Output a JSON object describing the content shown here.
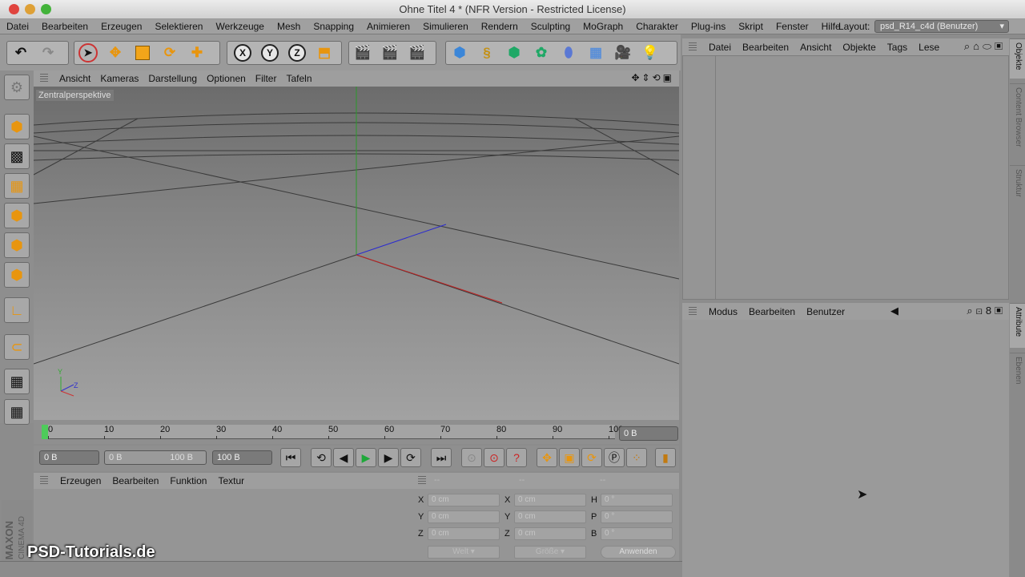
{
  "window": {
    "title": "Ohne Titel 4 * (NFR Version - Restricted License)"
  },
  "menubar": {
    "items": [
      "Datei",
      "Bearbeiten",
      "Erzeugen",
      "Selektieren",
      "Werkzeuge",
      "Mesh",
      "Snapping",
      "Animieren",
      "Simulieren",
      "Rendern",
      "Sculpting",
      "MoGraph",
      "Charakter",
      "Plug-ins",
      "Skript",
      "Fenster",
      "Hilfe"
    ],
    "layout_label": "Layout:",
    "layout_value": "psd_R14_c4d (Benutzer)"
  },
  "toolbar": {
    "axis_x": "X",
    "axis_y": "Y",
    "axis_z": "Z"
  },
  "viewport": {
    "menu": [
      "Ansicht",
      "Kameras",
      "Darstellung",
      "Optionen",
      "Filter",
      "Tafeln"
    ],
    "label": "Zentralperspektive",
    "axis_y": "Y",
    "axis_z": "Z"
  },
  "timeline": {
    "ticks": [
      "0",
      "10",
      "20",
      "30",
      "40",
      "50",
      "60",
      "70",
      "80",
      "90",
      "100"
    ],
    "current_frame": "0 B"
  },
  "transport": {
    "start": "0 B",
    "range_start": "0 B",
    "range_end": "100 B",
    "end": "100 B"
  },
  "material_manager": {
    "menu": [
      "Erzeugen",
      "Bearbeiten",
      "Funktion",
      "Textur"
    ],
    "brand_line1": "MAXON",
    "brand_line2": "CINEMA 4D"
  },
  "coordinates": {
    "header": [
      "--",
      "--",
      "--"
    ],
    "rows": [
      {
        "l1": "X",
        "v1": "0 cm",
        "l2": "X",
        "v2": "0 cm",
        "l3": "H",
        "v3": "0 °"
      },
      {
        "l1": "Y",
        "v1": "0 cm",
        "l2": "Y",
        "v2": "0 cm",
        "l3": "P",
        "v3": "0 °"
      },
      {
        "l1": "Z",
        "v1": "0 cm",
        "l2": "Z",
        "v2": "0 cm",
        "l3": "B",
        "v3": "0 °"
      }
    ],
    "mode": "Welt",
    "size": "Größe",
    "apply": "Anwenden"
  },
  "object_manager": {
    "menu": [
      "Datei",
      "Bearbeiten",
      "Ansicht",
      "Objekte",
      "Tags",
      "Lese"
    ]
  },
  "attribute_manager": {
    "menu": [
      "Modus",
      "Bearbeiten",
      "Benutzer"
    ]
  },
  "right_tabs": {
    "top": [
      "Objekte",
      "Content Browser",
      "Struktur"
    ],
    "bottom": [
      "Attribute",
      "Ebenen"
    ]
  },
  "watermark": "PSD-Tutorials.de"
}
